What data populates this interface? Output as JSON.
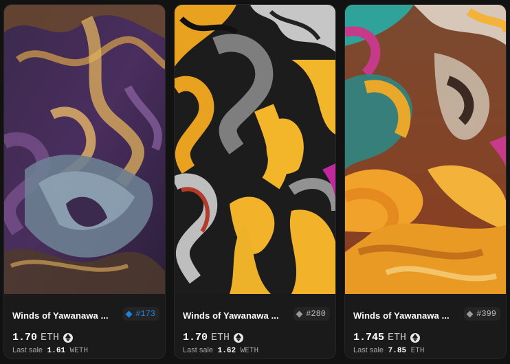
{
  "cards": [
    {
      "name": "Winds of Yawanawa ...",
      "token": "#173",
      "token_rarity": "rare",
      "price": "1.70",
      "currency": "ETH",
      "last_sale_label": "Last sale",
      "last_sale_value": "1.61",
      "last_sale_currency": "WETH"
    },
    {
      "name": "Winds of Yawanawa ...",
      "token": "#280",
      "token_rarity": "common",
      "price": "1.70",
      "currency": "ETH",
      "last_sale_label": "Last sale",
      "last_sale_value": "1.62",
      "last_sale_currency": "WETH"
    },
    {
      "name": "Winds of Yawanawa ...",
      "token": "#399",
      "token_rarity": "common",
      "price": "1.745",
      "currency": "ETH",
      "last_sale_label": "Last sale",
      "last_sale_value": "7.85",
      "last_sale_currency": "ETH"
    }
  ],
  "colors": {
    "background": "#121212",
    "card": "#1a1a1a",
    "rare_badge": "#2081e2",
    "common_badge": "#9a9a9a"
  }
}
